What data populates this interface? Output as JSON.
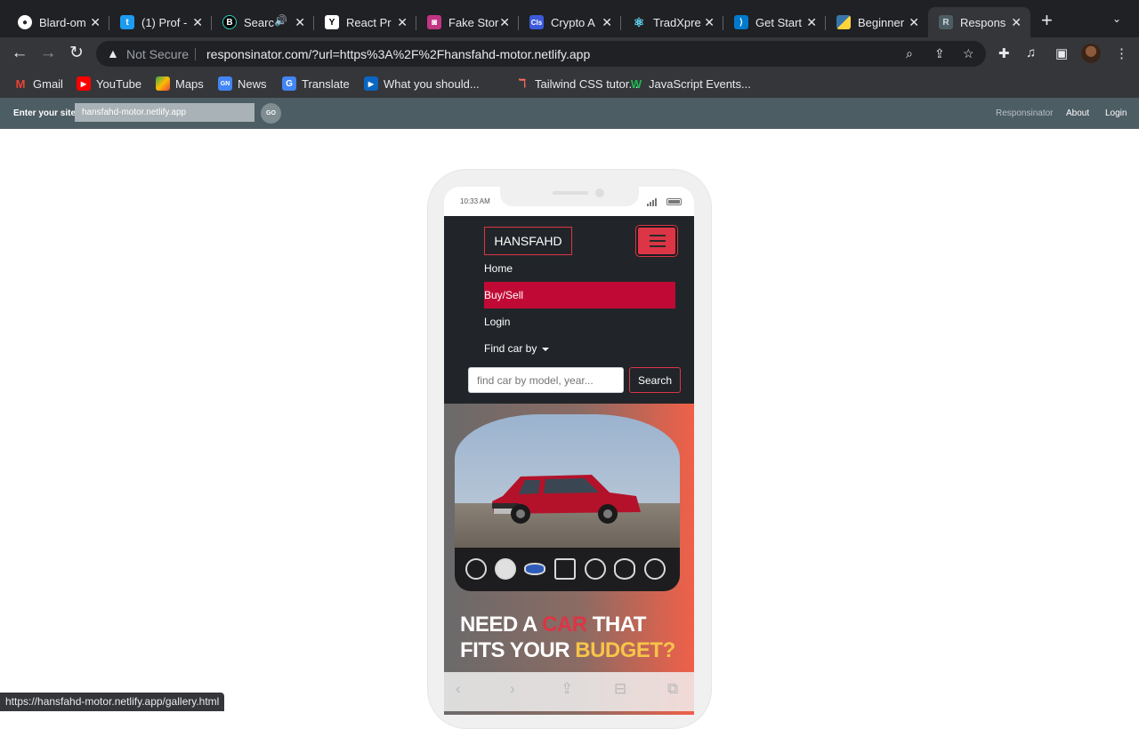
{
  "browser": {
    "tabs": [
      {
        "title": "Blard-om",
        "icon": "github-icon",
        "color": "#24292e"
      },
      {
        "title": "(1) Prof -",
        "icon": "twitter-icon",
        "color": "#1d9bf0"
      },
      {
        "title": "Searc",
        "icon": "binance-icon",
        "color": "#0b0e11"
      },
      {
        "title": "React Pr",
        "icon": "y-icon",
        "color": "#ffffff"
      },
      {
        "title": "Fake Stor",
        "icon": "store-icon",
        "color": "#c13584"
      },
      {
        "title": "Crypto A",
        "icon": "cls-icon",
        "color": "#3b5bdb"
      },
      {
        "title": "TradXpre",
        "icon": "react-icon",
        "color": "#20232a"
      },
      {
        "title": "Get Start",
        "icon": "vscode-icon",
        "color": "#007acc"
      },
      {
        "title": "Beginner",
        "icon": "python-icon",
        "color": "#3776ab"
      },
      {
        "title": "Respons",
        "icon": "r-icon",
        "color": "#5f6368"
      }
    ],
    "address": {
      "security": "Not Secure",
      "url": "responsinator.com/?url=https%3A%2F%2Fhansfahd-motor.netlify.app"
    },
    "bookmarks": [
      "Gmail",
      "YouTube",
      "Maps",
      "News",
      "Translate",
      "What you should...",
      "Tailwind CSS tutor...",
      "JavaScript Events..."
    ],
    "status_url": "https://hansfahd-motor.netlify.app/gallery.html"
  },
  "responsinator": {
    "label": "Enter your site",
    "site_value": "hansfahd-motor.netlify.app",
    "go": "GO",
    "links": [
      "Responsinator",
      "About",
      "Login"
    ]
  },
  "device": {
    "time": "10:33 AM"
  },
  "site": {
    "brand": "HANSFAHD",
    "nav": [
      "Home",
      "Buy/Sell",
      "Login",
      "Find car by"
    ],
    "active_nav": "Buy/Sell",
    "search_placeholder": "find car by model, year...",
    "search_button": "Search",
    "headline": {
      "part1": "NEED A ",
      "highlight1": "CAR",
      "part2": " THAT FITS YOUR ",
      "highlight2": "BUDGET?"
    },
    "colors": {
      "accent": "#dc3545",
      "active": "#c00a35",
      "yellow": "#f7c44a",
      "navbg": "#212529"
    }
  }
}
